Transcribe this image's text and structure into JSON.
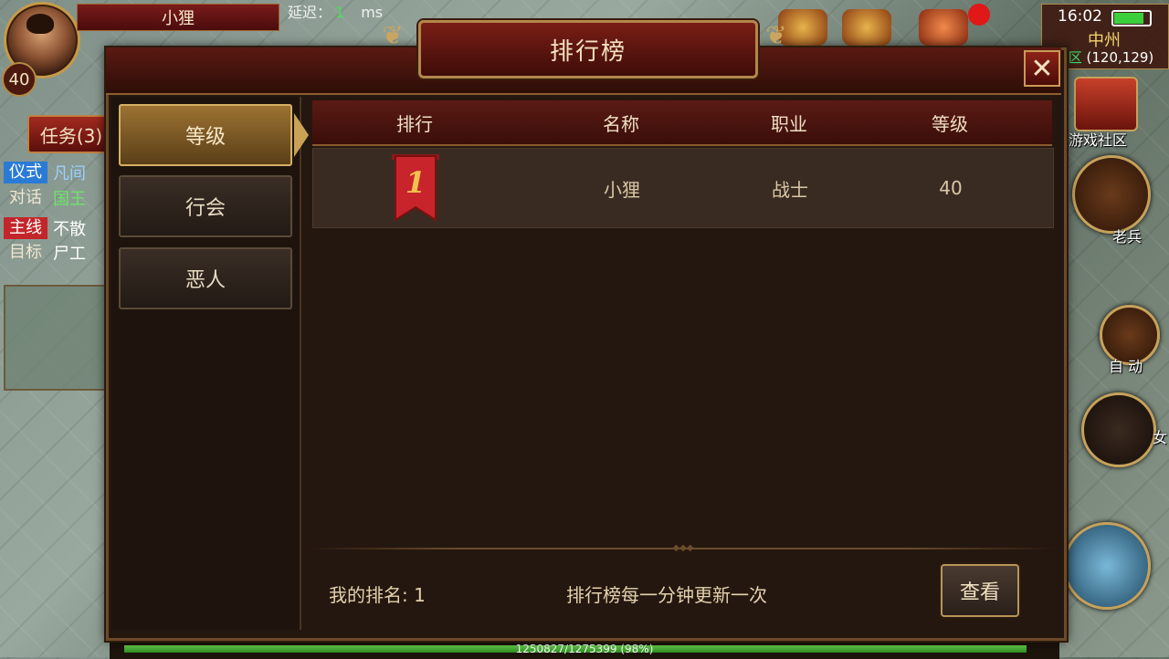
{
  "hud": {
    "player_name": "小狸",
    "player_level": "40",
    "latency_label": "延迟：",
    "latency_value": "1",
    "latency_unit": "ms",
    "task_button": "任务(3)",
    "quests": [
      {
        "tag": "仪式",
        "tag_color": "#2a7bd6",
        "value": "凡间"
      },
      {
        "tag": "对话",
        "tag_color": "",
        "value": "国王"
      },
      {
        "tag": "主线",
        "tag_color": "#c2262a",
        "value": "不散"
      },
      {
        "tag": "目标",
        "tag_color": "",
        "value": "尸工"
      }
    ],
    "clock": "16:02",
    "battery_level": 0.9,
    "map_name": "中州",
    "zone": "全区",
    "coordinates": "(120,129)",
    "community_label": "游戏社区",
    "veteran_label": "老兵",
    "auto_label": "自 动",
    "female_label": "女",
    "exp_text": "1250827/1275399 (98%)",
    "exp_fraction": 0.98
  },
  "dialog": {
    "title": "排行榜",
    "close_symbol": "✕",
    "tabs": [
      {
        "label": "等级",
        "active": true
      },
      {
        "label": "行会",
        "active": false
      },
      {
        "label": "恶人",
        "active": false
      }
    ],
    "columns": [
      "排行",
      "名称",
      "职业",
      "等级"
    ],
    "rows": [
      {
        "rank": "1",
        "name": "小狸",
        "class": "战士",
        "level": "40"
      }
    ],
    "my_rank": "我的排名: 1",
    "update_note": "排行榜每一分钟更新一次",
    "view_button": "查看"
  },
  "colors": {
    "accent_gold": "#c9a256",
    "header_red": "#5b1a14",
    "panel_bg": "#24170f",
    "exp_green": "#3ccf3c"
  }
}
